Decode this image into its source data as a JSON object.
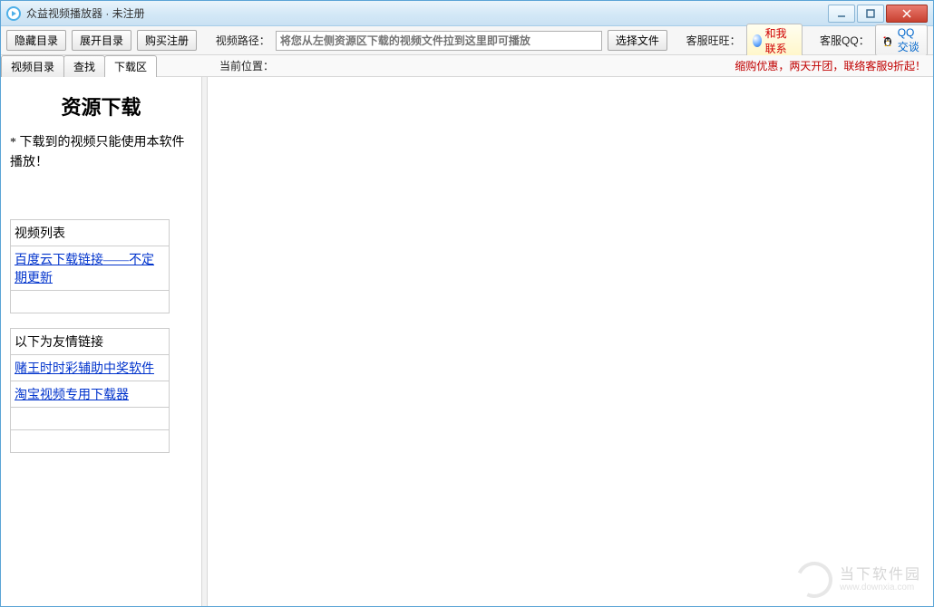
{
  "window": {
    "title": "众益视频播放器 · 未注册"
  },
  "toolbar": {
    "hide_dir": "隐藏目录",
    "expand_dir": "展开目录",
    "buy_register": "购买注册",
    "video_path_label": "视频路径：",
    "video_path_placeholder": "将您从左侧资源区下载的视频文件拉到这里即可播放",
    "choose_file": "选择文件",
    "kf_wangwang_label": "客服旺旺：",
    "wangwang_text": "和我联系",
    "kf_qq_label": "客服QQ：",
    "qq_text": "QQ交谈"
  },
  "subbar": {
    "tabs": [
      "视频目录",
      "查找",
      "下载区"
    ],
    "current_pos_label": "当前位置：",
    "promo_text": "缩购优惠，两天开团，联络客服9折起！"
  },
  "sidebar": {
    "title": "资源下载",
    "note": "* 下载到的视频只能使用本软件播放！",
    "table1_header": "视频列表",
    "table1_link": "百度云下载链接——不定期更新",
    "table2_header": "以下为友情链接",
    "table2_link1": "赌王时时彩辅助中奖软件",
    "table2_link2": "淘宝视频专用下载器"
  },
  "watermark": {
    "cn": "当下软件园",
    "en": "www.downxia.com"
  }
}
